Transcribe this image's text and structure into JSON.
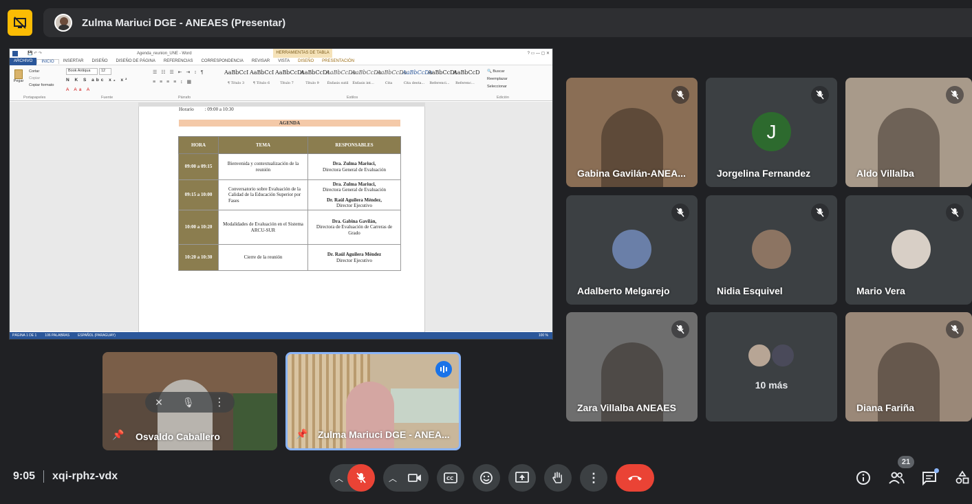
{
  "presenter": {
    "title": "Zulma Mariuci DGE - ANEAES (Presentar)"
  },
  "word": {
    "window_title": "Agenda_reunion_UNE - Word",
    "table_tools": "HERRAMIENTAS DE TABLA",
    "tabs": [
      "ARCHIVO",
      "INICIO",
      "INSERTAR",
      "DISEÑO",
      "DISEÑO DE PÁGINA",
      "REFERENCIAS",
      "CORRESPONDENCIA",
      "REVISAR",
      "VISTA",
      "DISEÑO",
      "PRESENTACIÓN"
    ],
    "clipboard": {
      "paste": "Pegar",
      "cut": "Cortar",
      "copy": "Copiar",
      "format": "Copiar formato",
      "group": "Portapapeles"
    },
    "font": {
      "name": "Book Antiqua",
      "size": "12",
      "group": "Fuente"
    },
    "paragraph_group": "Párrafo",
    "styles_group": "Estilos",
    "editing": {
      "find": "Buscar",
      "replace": "Reemplazar",
      "select": "Seleccionar",
      "group": "Edición"
    },
    "styles": [
      {
        "sample": "AaBbCcI",
        "name": "¶ Título 3"
      },
      {
        "sample": "AaBbCcI",
        "name": "¶ Título 6"
      },
      {
        "sample": "AaBbCcDt",
        "name": "Título 7"
      },
      {
        "sample": "AaBbCcDt",
        "name": "Título 9"
      },
      {
        "sample": "AaBbCcDa",
        "name": "Énfasis sutil"
      },
      {
        "sample": "AaBbCcDa",
        "name": "Énfasis int..."
      },
      {
        "sample": "AaBbCcDa",
        "name": "Cita"
      },
      {
        "sample": "AaBbCcDa",
        "name": "Cita desta..."
      },
      {
        "sample": "AaBbCcDt",
        "name": "Referenci..."
      },
      {
        "sample": "AaBbCcD",
        "name": "Referenc..."
      }
    ],
    "horario_label": "Horario",
    "horario_value": ": 09:00 a 10:30",
    "agenda_title": "AGENDA",
    "table": {
      "headers": [
        "HORA",
        "TEMA",
        "RESPONSABLES"
      ],
      "rows": [
        {
          "hora": "09:00 a 09:15",
          "tema": "Bienvenida y contextualización de la reunión",
          "resp1": "Dra. Zulma Mariuci,",
          "resp2": "Directora General de Evaluación",
          "resp3": "",
          "resp4": ""
        },
        {
          "hora": "09:15 a 10:00",
          "tema": "Conversatorio sobre Evaluación de la Calidad de la Educación Superior por Fases",
          "resp1": "Dra. Zulma Mariuci,",
          "resp2": "Directora General de Evaluación",
          "resp3": "Dr. Raúl Aguilera Méndez,",
          "resp4": "Director Ejecutivo"
        },
        {
          "hora": "10:00 a 10:20",
          "tema": "Modalidades de Evaluación en el Sistema ARCU-SUR",
          "resp1": "Dra. Gabina Gavilán,",
          "resp2": "Directora de Evaluación de Carreras de Grado",
          "resp3": "",
          "resp4": ""
        },
        {
          "hora": "10:20 a 10:30",
          "tema": "Cierre de la reunión",
          "resp1": "Dr. Raúl Aguilera Méndez",
          "resp2": "Director Ejecutivo",
          "resp3": "",
          "resp4": ""
        }
      ]
    },
    "status": {
      "page": "PÁGINA 1 DE 1",
      "words": "106 PALABRAS",
      "lang": "ESPAÑOL (PARAGUAY)",
      "zoom": "100 %"
    }
  },
  "participants": [
    {
      "name": "Gabina Gavilán-ANEA...",
      "type": "video",
      "color": "#8a6e55"
    },
    {
      "name": "Jorgelina Fernandez",
      "type": "initial",
      "initial": "J",
      "color": "#2d6a2e"
    },
    {
      "name": "Aldo Villalba",
      "type": "video",
      "color": "#a89a8a"
    },
    {
      "name": "Adalberto Melgarejo",
      "type": "avatar",
      "color": "#6a7fa8"
    },
    {
      "name": "Nidia Esquivel",
      "type": "avatar",
      "color": "#8c7462"
    },
    {
      "name": "Mario Vera",
      "type": "avatar",
      "color": "#d8cfc6"
    },
    {
      "name": "Zara Villalba ANEAES",
      "type": "video",
      "color": "#6e6e6e"
    },
    {
      "name": "Diana Fariña",
      "type": "video",
      "color": "#9a8878"
    }
  ],
  "more": {
    "label": "10 más"
  },
  "pinned": [
    {
      "name": "Osvaldo Caballero"
    },
    {
      "name": "Zulma Mariuci DGE - ANEA..."
    }
  ],
  "meeting": {
    "time": "9:05",
    "code": "xqi-rphz-vdx",
    "participants_count": "21"
  },
  "colors": {
    "accent": "#8ab4f8",
    "end_call": "#ea4335",
    "present": "#fbbc04",
    "table_header": "#8b7d4f"
  }
}
